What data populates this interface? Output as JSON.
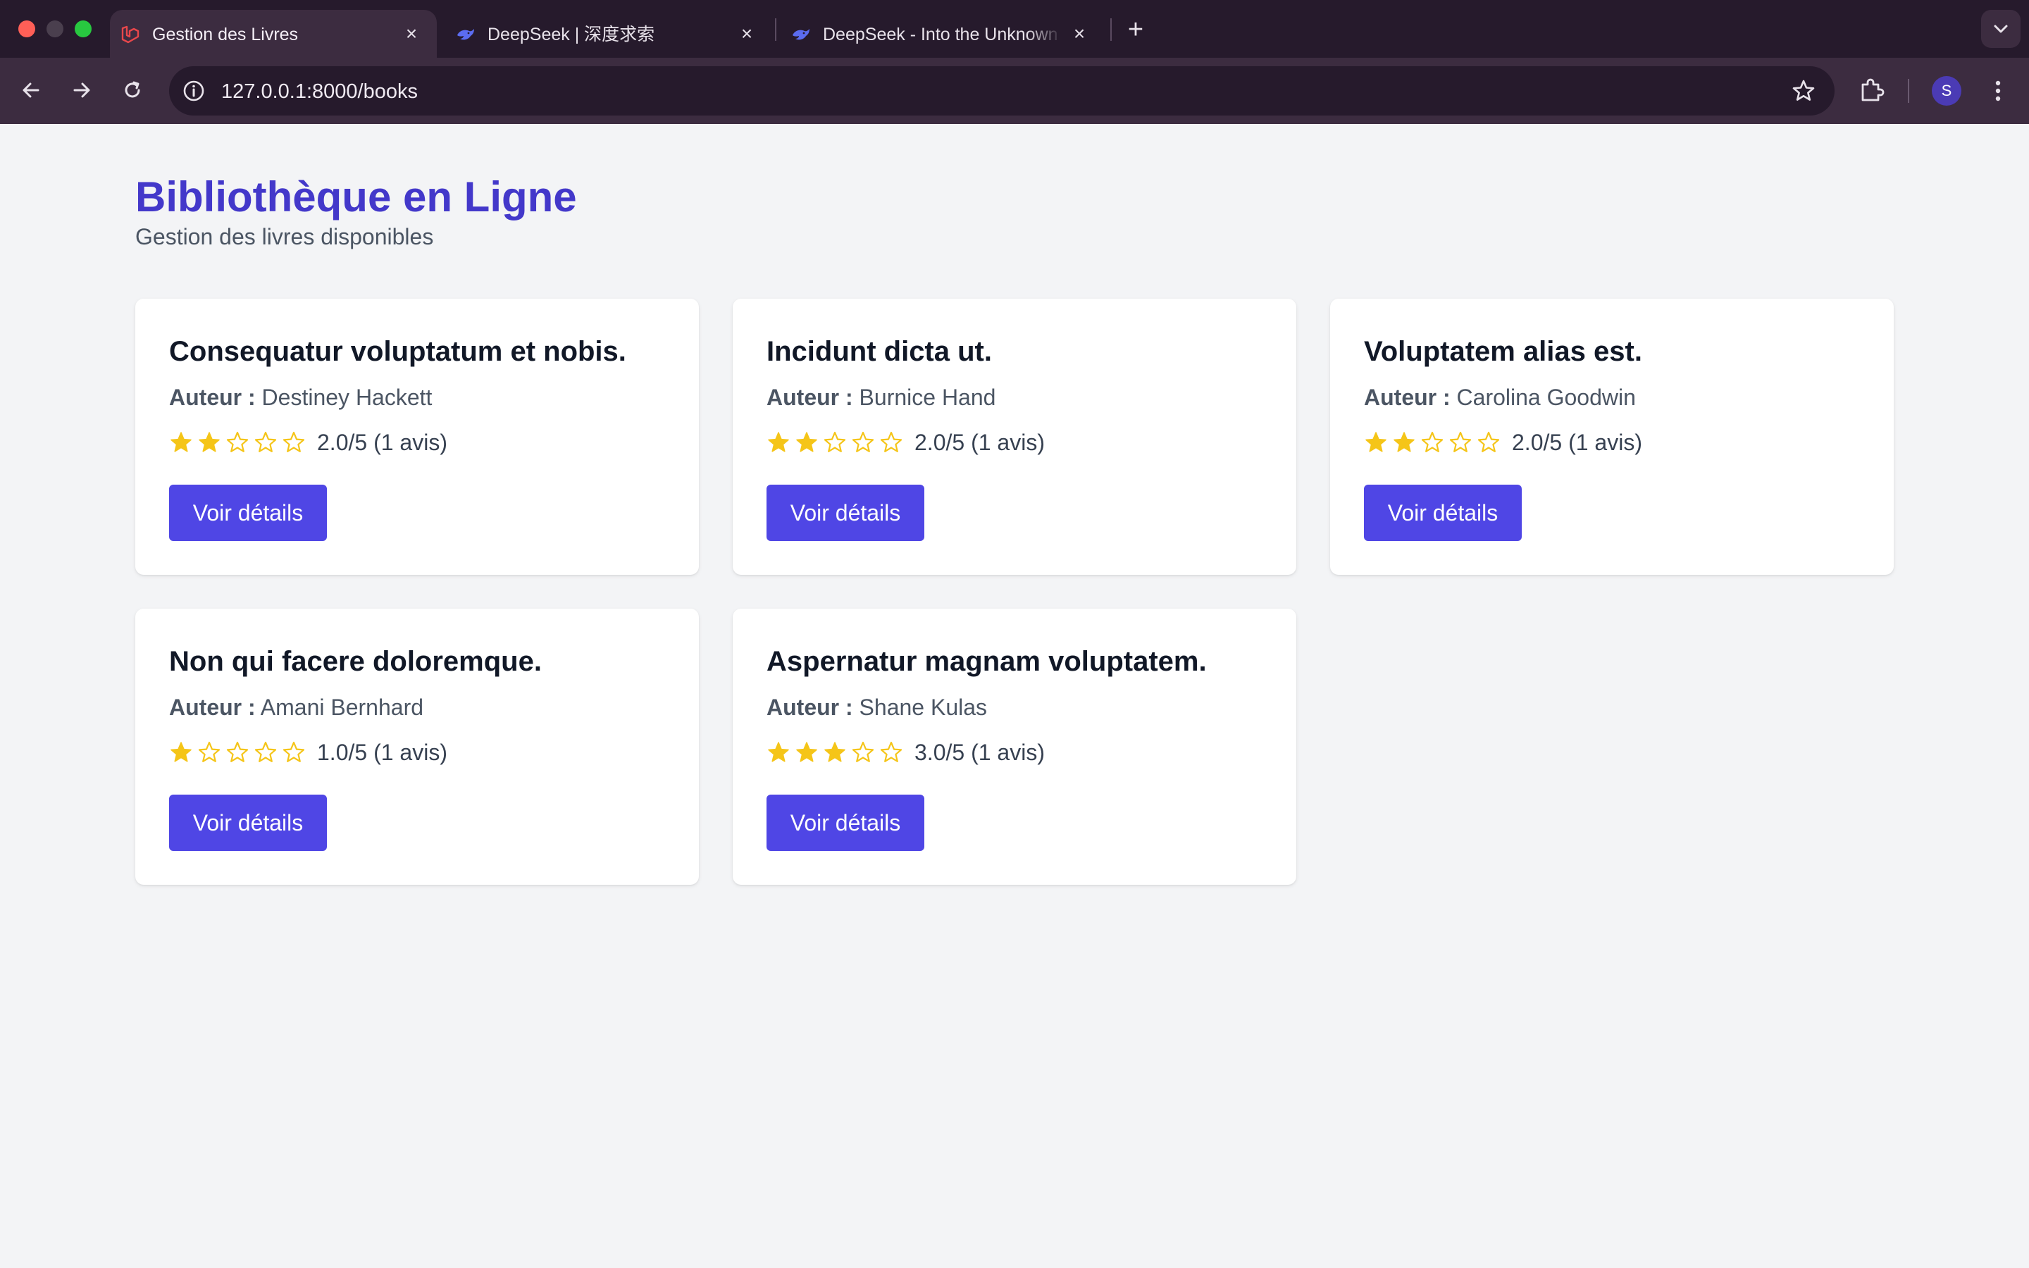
{
  "browser": {
    "tabs": [
      {
        "title": "Gestion des Livres",
        "active": true,
        "icon": "laravel-icon"
      },
      {
        "title": "DeepSeek | 深度求索",
        "active": false,
        "icon": "deepseek-whale-icon"
      },
      {
        "title": "DeepSeek - Into the Unknown",
        "active": false,
        "icon": "deepseek-whale-icon"
      }
    ],
    "url": "127.0.0.1:8000/books",
    "profile_initial": "S",
    "colors": {
      "tabbar": "#261a2c",
      "toolbar": "#3c2c40"
    }
  },
  "page": {
    "title": "Bibliothèque en Ligne",
    "subtitle": "Gestion des livres disponibles",
    "author_label": "Auteur :",
    "details_label": "Voir détails",
    "colors": {
      "accent": "#4338ca",
      "button": "#4f46e5",
      "star": "#f5c518"
    }
  },
  "books": [
    {
      "title": "Consequatur voluptatum et nobis.",
      "author": "Destiney Hackett",
      "rating": 2,
      "rating_text": "2.0/5 (1 avis)"
    },
    {
      "title": "Incidunt dicta ut.",
      "author": "Burnice Hand",
      "rating": 2,
      "rating_text": "2.0/5 (1 avis)"
    },
    {
      "title": "Voluptatem alias est.",
      "author": "Carolina Goodwin",
      "rating": 2,
      "rating_text": "2.0/5 (1 avis)"
    },
    {
      "title": "Non qui facere doloremque.",
      "author": "Amani Bernhard",
      "rating": 1,
      "rating_text": "1.0/5 (1 avis)"
    },
    {
      "title": "Aspernatur magnam voluptatem.",
      "author": "Shane Kulas",
      "rating": 3,
      "rating_text": "3.0/5 (1 avis)"
    }
  ]
}
